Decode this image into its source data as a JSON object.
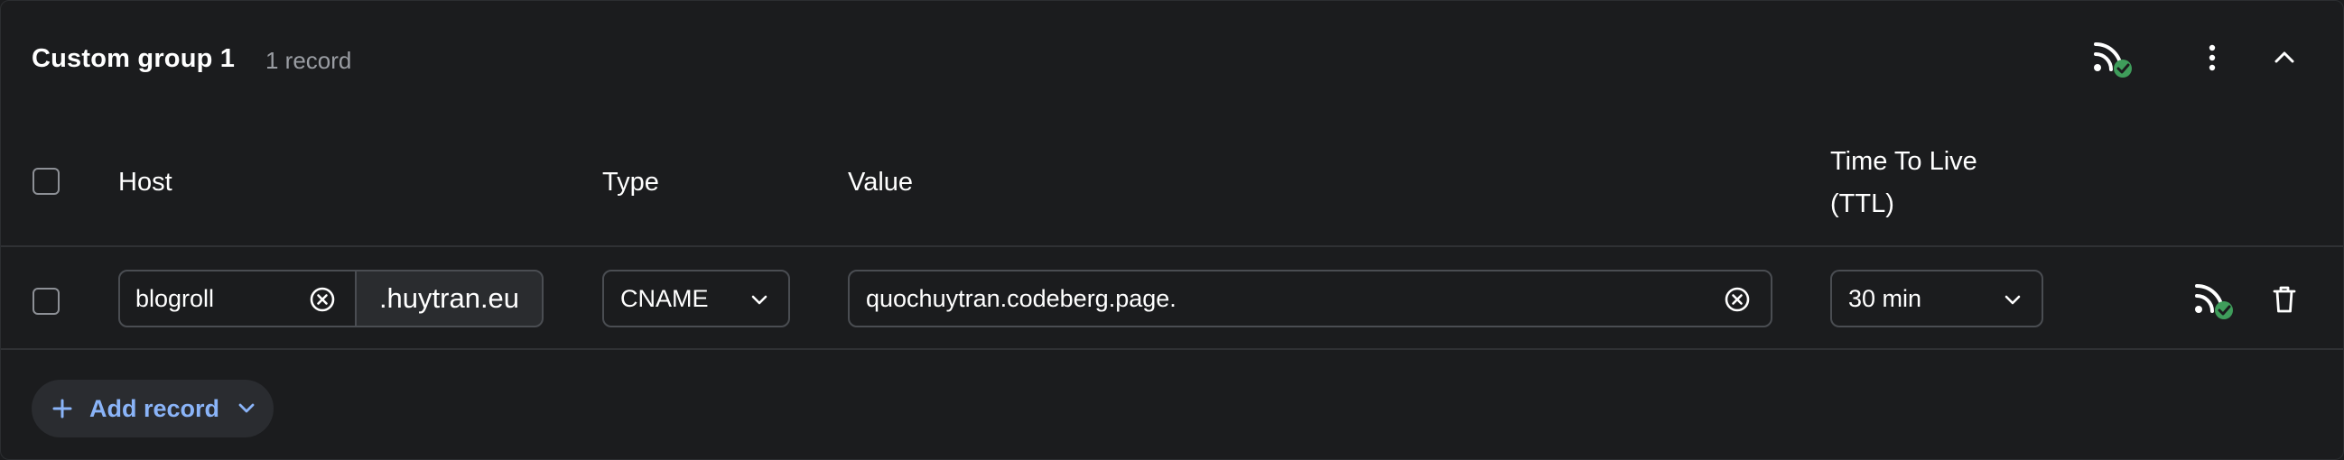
{
  "group": {
    "title": "Custom group 1",
    "record_count": "1 record",
    "icons": [
      "rss-check-icon",
      "more-vert-icon",
      "chevron-up-icon"
    ]
  },
  "table": {
    "headers": {
      "host": "Host",
      "type": "Type",
      "value": "Value",
      "ttl_line1": "Time To Live",
      "ttl_line2": "(TTL)"
    },
    "rows": [
      {
        "host": "blogroll",
        "domain_suffix": ".huytran.eu",
        "type": "CNAME",
        "value": "quochuytran.codeberg.page.",
        "ttl": "30 min"
      }
    ]
  },
  "actions": {
    "add_record": "Add record"
  },
  "colors": {
    "background": "#1b1c1e",
    "accent": "#8ab4f8",
    "status_green": "#3f9d5b",
    "border": "#4a4d52"
  }
}
